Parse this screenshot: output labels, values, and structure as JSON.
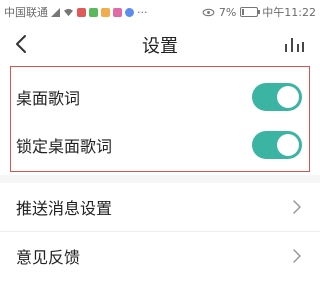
{
  "status_bar": {
    "carrier": "中国联通",
    "battery": "7%",
    "time": "中午11:22"
  },
  "header": {
    "title": "设置",
    "back_icon": "back-arrow-icon",
    "right_icon": "stats-bars-icon"
  },
  "settings": {
    "desktop_lyrics": {
      "label": "桌面歌词",
      "enabled": true
    },
    "lock_desktop_lyrics": {
      "label": "锁定桌面歌词",
      "enabled": true
    },
    "push_settings": {
      "label": "推送消息设置"
    },
    "feedback": {
      "label": "意见反馈"
    }
  },
  "colors": {
    "toggle_on": "#3bb4a3",
    "highlight_border": "#d9534f"
  }
}
